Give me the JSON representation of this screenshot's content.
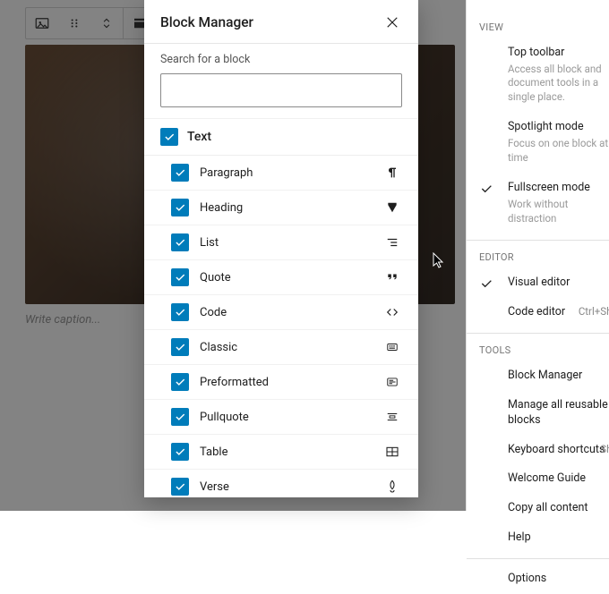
{
  "toolbar": {
    "tools": [
      "image-block-icon",
      "drag-handle-icon",
      "chevrons-icon",
      "align-icon"
    ]
  },
  "caption_placeholder": "Write caption...",
  "sidebar": {
    "sections": [
      {
        "label": "VIEW",
        "items": [
          {
            "label": "Top toolbar",
            "desc": "Access all block and document tools in a single place.",
            "checked": false
          },
          {
            "label": "Spotlight mode",
            "desc": "Focus on one block at a time",
            "checked": false
          },
          {
            "label": "Fullscreen mode",
            "desc": "Work without distraction",
            "checked": true
          }
        ]
      },
      {
        "label": "EDITOR",
        "items": [
          {
            "label": "Visual editor",
            "checked": true
          },
          {
            "label": "Code editor",
            "shortcut": "Ctrl+Shift"
          }
        ]
      },
      {
        "label": "TOOLS",
        "items": [
          {
            "label": "Block Manager"
          },
          {
            "label": "Manage all reusable blocks"
          },
          {
            "label": "Keyboard shortcuts",
            "shortcut": "Shift"
          },
          {
            "label": "Welcome Guide"
          },
          {
            "label": "Copy all content"
          },
          {
            "label": "Help"
          }
        ]
      },
      {
        "label": "",
        "items": [
          {
            "label": "Options"
          }
        ]
      }
    ]
  },
  "modal": {
    "title": "Block Manager",
    "search_label": "Search for a block",
    "category": {
      "label": "Text",
      "checked": true,
      "blocks": [
        {
          "name": "Paragraph",
          "icon": "paragraph-icon",
          "checked": true
        },
        {
          "name": "Heading",
          "icon": "heading-icon",
          "checked": true
        },
        {
          "name": "List",
          "icon": "list-icon",
          "checked": true
        },
        {
          "name": "Quote",
          "icon": "quote-icon",
          "checked": true
        },
        {
          "name": "Code",
          "icon": "code-icon",
          "checked": true
        },
        {
          "name": "Classic",
          "icon": "classic-icon",
          "checked": true
        },
        {
          "name": "Preformatted",
          "icon": "preformatted-icon",
          "checked": true
        },
        {
          "name": "Pullquote",
          "icon": "pullquote-icon",
          "checked": true
        },
        {
          "name": "Table",
          "icon": "table-icon",
          "checked": true
        },
        {
          "name": "Verse",
          "icon": "verse-icon",
          "checked": true
        }
      ]
    }
  }
}
